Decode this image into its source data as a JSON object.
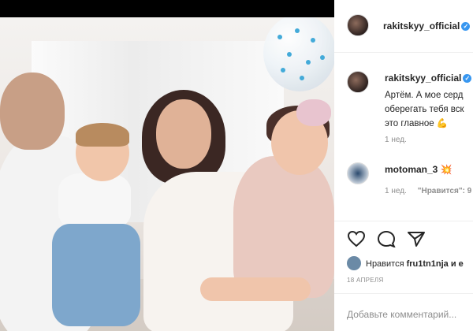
{
  "post": {
    "author": "rakitskyy_official",
    "verified_mark": "✓",
    "caption": [
      "Артём. А мое серд",
      "оберегать тебя вск",
      "это главное"
    ],
    "caption_emoji": "💪",
    "caption_age": "1 нед.",
    "likes_prefix": "Нравится",
    "likes_user": "fru1tn1nja",
    "likes_suffix": "и е",
    "date": "18 АПРЕЛЯ",
    "comment_placeholder": "Добавьте комментарий..."
  },
  "comments": [
    {
      "user": "motoman_3",
      "emoji": "💥",
      "age": "1 нед.",
      "likes": "\"Нравится\": 9"
    }
  ],
  "icons": [
    "heart-icon",
    "comment-icon",
    "share-icon"
  ],
  "colors": {
    "accent": "#3897f0",
    "text": "#262626",
    "muted": "#8e8e8e"
  }
}
